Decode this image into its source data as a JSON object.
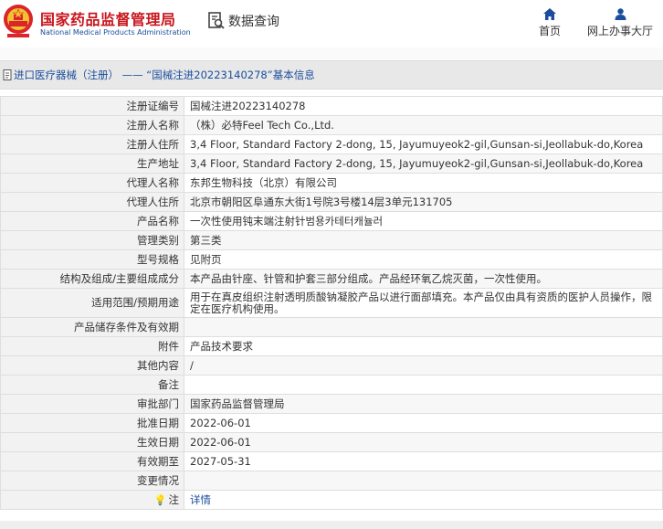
{
  "header": {
    "site_name": "国家药品监督管理局",
    "site_name_en": "National Medical Products Administration",
    "query_label": "数据查询",
    "nav": [
      {
        "label": "首页",
        "icon": "home-icon"
      },
      {
        "label": "网上办事大厅",
        "icon": "user-icon"
      }
    ]
  },
  "titlebar": {
    "text": "进口医疗器械（注册） —— “国械注进20223140278”基本信息"
  },
  "fields": [
    {
      "label": "注册证编号",
      "value": "国械注进20223140278"
    },
    {
      "label": "注册人名称",
      "value": "（株）必特Feel Tech Co.,Ltd."
    },
    {
      "label": "注册人住所",
      "value": "3,4 Floor, Standard Factory 2-dong, 15, Jayumuyeok2-gil,Gunsan-si,Jeollabuk-do,Korea"
    },
    {
      "label": "生产地址",
      "value": "3,4 Floor, Standard Factory 2-dong, 15, Jayumuyeok2-gil,Gunsan-si,Jeollabuk-do,Korea"
    },
    {
      "label": "代理人名称",
      "value": "东邦生物科技（北京）有限公司"
    },
    {
      "label": "代理人住所",
      "value": "北京市朝阳区阜通东大街1号院3号楼14层3单元131705"
    },
    {
      "label": "产品名称",
      "value": "一次性使用钝末端注射针범용카테터캐뉼러"
    },
    {
      "label": "管理类别",
      "value": "第三类"
    },
    {
      "label": "型号规格",
      "value": "见附页"
    },
    {
      "label": "结构及组成/主要组成成分",
      "value": "本产品由针座、针管和护套三部分组成。产品经环氧乙烷灭菌，一次性使用。"
    },
    {
      "label": "适用范围/预期用途",
      "value": "用于在真皮组织注射透明质酸钠凝胶产品以进行面部填充。本产品仅由具有资质的医护人员操作，限定在医疗机构使用。"
    },
    {
      "label": "产品储存条件及有效期",
      "value": ""
    },
    {
      "label": "附件",
      "value": "产品技术要求"
    },
    {
      "label": "其他内容",
      "value": "/"
    },
    {
      "label": "备注",
      "value": ""
    },
    {
      "label": "审批部门",
      "value": "国家药品监督管理局"
    },
    {
      "label": "批准日期",
      "value": "2022-06-01"
    },
    {
      "label": "生效日期",
      "value": "2022-06-01"
    },
    {
      "label": "有效期至",
      "value": "2027-05-31"
    },
    {
      "label": "变更情况",
      "value": ""
    }
  ],
  "note": {
    "label": "注",
    "link": "详情",
    "icon": "lightbulb-icon"
  },
  "colors": {
    "brand_red": "#c8161d",
    "link_blue": "#1b4d9c"
  }
}
